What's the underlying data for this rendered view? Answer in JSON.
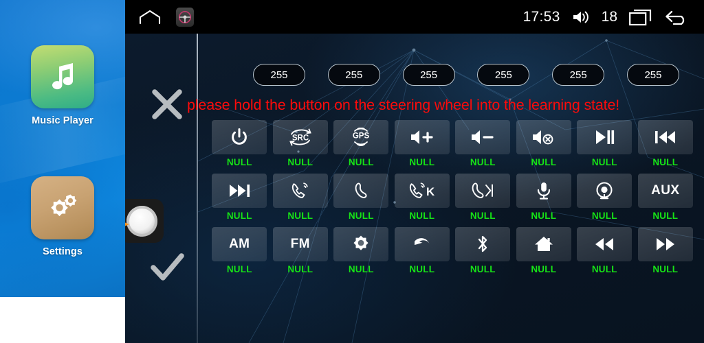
{
  "sidebar": {
    "apps": [
      {
        "label": "Music Player",
        "icon": "music-note-icon",
        "color": "#59c07f"
      },
      {
        "label": "Settings",
        "icon": "gears-icon",
        "color": "#c4a070"
      }
    ]
  },
  "statusbar": {
    "home_icon": "home-outline-icon",
    "steering_icon": "steering-wheel-icon",
    "time": "17:53",
    "volume_icon": "speaker-icon",
    "volume_level": "18",
    "recents_icon": "recent-apps-icon",
    "back_icon": "back-arrow-icon"
  },
  "panel": {
    "cancel_icon": "close-x-icon",
    "confirm_icon": "checkmark-icon",
    "knob_icon": "rotary-knob-icon",
    "pointer_icon": "orange-arrow-icon",
    "warning_text": "please hold the button on the steering wheel into the learning state!",
    "warning_color": "#fb0b0b",
    "value_label_color": "#16e316",
    "values": [
      "255",
      "255",
      "255",
      "255",
      "255",
      "255"
    ],
    "buttons": [
      {
        "icon": "power-icon",
        "text": "",
        "label": "NULL"
      },
      {
        "icon": "src-source-icon",
        "text": "",
        "label": "NULL"
      },
      {
        "icon": "gps-icon",
        "text": "",
        "label": "NULL"
      },
      {
        "icon": "volume-up-icon",
        "text": "",
        "label": "NULL"
      },
      {
        "icon": "volume-down-icon",
        "text": "",
        "label": "NULL"
      },
      {
        "icon": "mute-icon",
        "text": "",
        "label": "NULL"
      },
      {
        "icon": "play-pause-icon",
        "text": "",
        "label": "NULL"
      },
      {
        "icon": "previous-track-icon",
        "text": "",
        "label": "NULL"
      },
      {
        "icon": "next-track-icon",
        "text": "",
        "label": "NULL"
      },
      {
        "icon": "call-answer-icon",
        "text": "",
        "label": "NULL"
      },
      {
        "icon": "call-hangup-icon",
        "text": "",
        "label": "NULL"
      },
      {
        "icon": "call-answer-k-icon",
        "text": "",
        "label": "NULL"
      },
      {
        "icon": "call-hangup-skip-icon",
        "text": "",
        "label": "NULL"
      },
      {
        "icon": "microphone-icon",
        "text": "",
        "label": "NULL"
      },
      {
        "icon": "camera-icon",
        "text": "",
        "label": "NULL"
      },
      {
        "icon": "text-icon",
        "text": "AUX",
        "label": "NULL"
      },
      {
        "icon": "text-icon",
        "text": "AM",
        "label": "NULL"
      },
      {
        "icon": "text-icon",
        "text": "FM",
        "label": "NULL"
      },
      {
        "icon": "gear-icon",
        "text": "",
        "label": "NULL"
      },
      {
        "icon": "back-curved-icon",
        "text": "",
        "label": "NULL"
      },
      {
        "icon": "bluetooth-icon",
        "text": "",
        "label": "NULL"
      },
      {
        "icon": "home-icon",
        "text": "",
        "label": "NULL"
      },
      {
        "icon": "rewind-icon",
        "text": "",
        "label": "NULL"
      },
      {
        "icon": "fast-forward-icon",
        "text": "",
        "label": "NULL"
      }
    ]
  }
}
